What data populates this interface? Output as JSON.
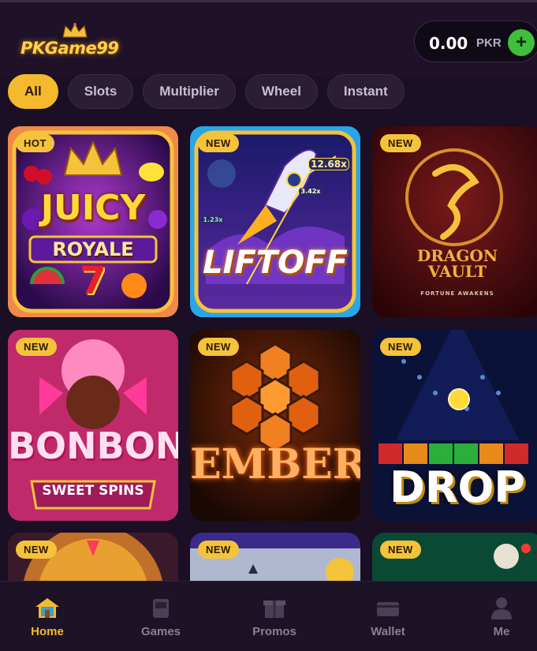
{
  "header": {
    "logo_text": "PKGame99",
    "balance": {
      "amount": "0.00",
      "currency": "PKR",
      "add_label": "+"
    }
  },
  "tabs": [
    {
      "label": "All",
      "active": true
    },
    {
      "label": "Slots"
    },
    {
      "label": "Multiplier"
    },
    {
      "label": "Wheel"
    },
    {
      "label": "Instant"
    }
  ],
  "games": [
    {
      "badge": "HOT",
      "title_top": "JUICY",
      "title_bottom": "ROYALE",
      "numeral": "7"
    },
    {
      "badge": "NEW",
      "title": "LIFTOFF",
      "multipliers": [
        "12.68x",
        "3.42x",
        "1.23x"
      ]
    },
    {
      "badge": "NEW",
      "title_top": "DRAGON",
      "title_bottom": "VAULT",
      "tagline": "FORTUNE AWAKENS"
    },
    {
      "badge": "NEW",
      "title": "BONBON",
      "subtitle": "SWEET SPINS"
    },
    {
      "badge": "NEW",
      "title": "EMBER"
    },
    {
      "badge": "NEW",
      "title": "DROP"
    },
    {
      "badge": "NEW"
    },
    {
      "badge": "NEW"
    },
    {
      "badge": "NEW"
    }
  ],
  "nav": [
    {
      "label": "Home",
      "icon": "home-icon",
      "active": true
    },
    {
      "label": "Games",
      "icon": "games-icon"
    },
    {
      "label": "Promos",
      "icon": "gift-icon"
    },
    {
      "label": "Wallet",
      "icon": "wallet-icon"
    },
    {
      "label": "Me",
      "icon": "user-icon"
    }
  ],
  "colors": {
    "accent": "#f5b92d",
    "add_button": "#3fbf3a",
    "background": "#1a0f24"
  }
}
